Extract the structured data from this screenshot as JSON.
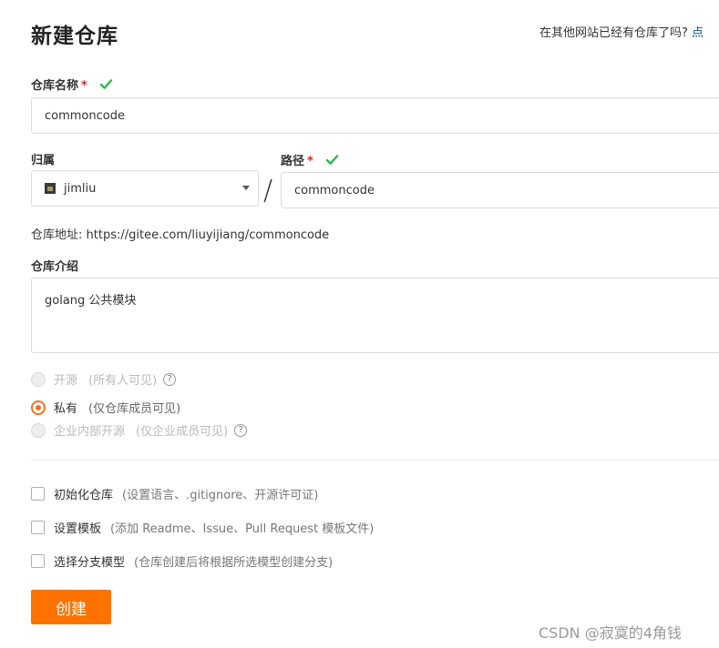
{
  "header": {
    "title": "新建仓库",
    "import_hint": "在其他网站已经有仓库了吗?",
    "import_link": "点"
  },
  "repo_name": {
    "label": "仓库名称",
    "required_mark": "*",
    "value": "commoncode"
  },
  "owner": {
    "label": "归属",
    "value": "jimliu"
  },
  "separator": "/",
  "path": {
    "label": "路径",
    "required_mark": "*",
    "value": "commoncode"
  },
  "repo_address": {
    "label": "仓库地址:",
    "value": "https://gitee.com/liuyijiang/commoncode"
  },
  "description": {
    "label": "仓库介绍",
    "value": "golang 公共模块"
  },
  "visibility": [
    {
      "label": "开源",
      "note": "(所有人可见)",
      "selected": false,
      "disabled": true,
      "help": "?"
    },
    {
      "label": "私有",
      "note": "(仅仓库成员可见)",
      "selected": true,
      "disabled": false
    },
    {
      "label": "企业内部开源",
      "note": "(仅企业成员可见)",
      "selected": false,
      "disabled": true,
      "help": "?"
    }
  ],
  "options": [
    {
      "label": "初始化仓库",
      "note": "(设置语言、.gitignore、开源许可证)",
      "checked": false
    },
    {
      "label": "设置模板",
      "note": "(添加 Readme、Issue、Pull Request 模板文件)",
      "checked": false
    },
    {
      "label": "选择分支模型",
      "note": "(仓库创建后将根据所选模型创建分支)",
      "checked": false
    }
  ],
  "create_button": "创建",
  "watermark": "CSDN @寂寞的4角钱",
  "colors": {
    "accent": "#fe7300",
    "valid": "#21ba45",
    "required": "#db2828"
  }
}
